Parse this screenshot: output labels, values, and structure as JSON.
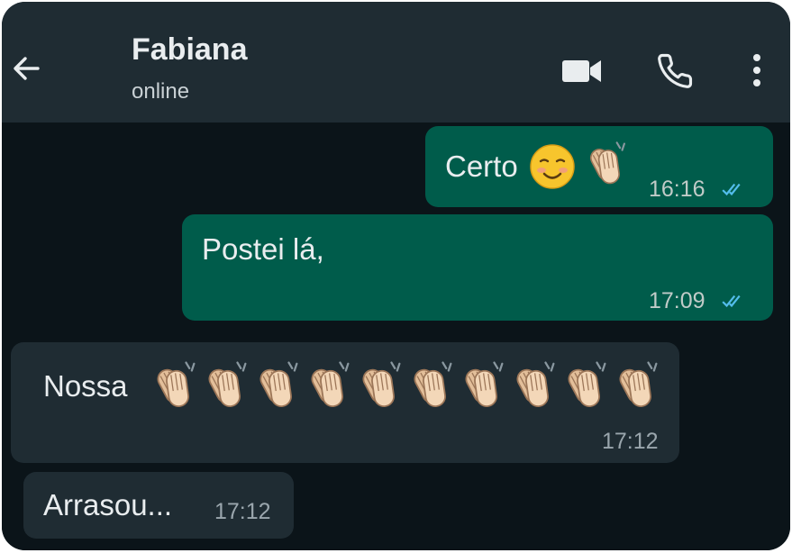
{
  "header": {
    "contact_name": "Fabiana",
    "status": "online",
    "back_icon": "arrow-left-icon",
    "video_icon": "video-camera-icon",
    "call_icon": "phone-icon",
    "menu_icon": "more-vertical-icon"
  },
  "messages": [
    {
      "direction": "outgoing",
      "text": "Certo",
      "emojis": [
        "smiling-face-emoji",
        "clapping-hands-emoji"
      ],
      "time": "16:16",
      "status": "read"
    },
    {
      "direction": "outgoing",
      "text": "Postei lá,",
      "time": "17:09",
      "status": "read"
    },
    {
      "direction": "incoming",
      "text": "Nossa",
      "emoji_count": 10,
      "emoji": "clapping-hands-emoji",
      "time": "17:12"
    },
    {
      "direction": "incoming",
      "text": "Arrasou...",
      "time": "17:12"
    }
  ],
  "colors": {
    "header_bg": "#1f2c33",
    "chat_bg": "#0b1419",
    "outgoing_bubble": "#005c4b",
    "incoming_bubble": "#1f2c33",
    "read_ticks": "#53bdeb"
  }
}
